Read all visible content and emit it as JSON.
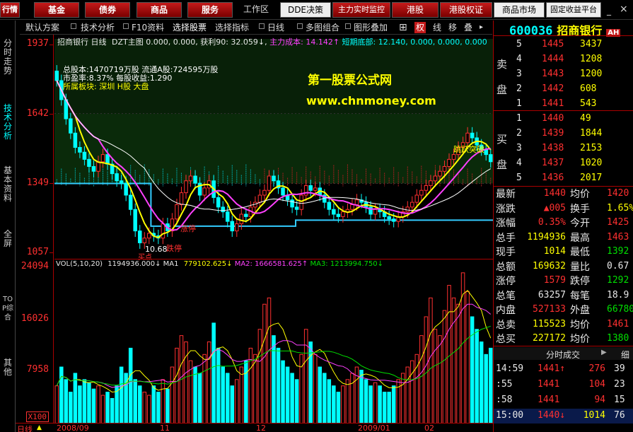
{
  "toolbar": {
    "buttons": [
      "行情",
      "基金",
      "债券",
      "商品",
      "服务"
    ],
    "workspace": "工作区",
    "tabs": [
      "DDE决策",
      "主力实时监控",
      "港股",
      "港股权证",
      "商品市场",
      "固定收益平台"
    ]
  },
  "subbar": {
    "items": [
      "默认方案",
      "技术分析",
      "F10资料",
      "选择股票",
      "选择指标",
      "日线",
      "多图组合",
      "图形叠加"
    ],
    "right_icons": [
      "权",
      "线",
      "移",
      "叠"
    ]
  },
  "left_tabs": [
    "分时走势",
    "技术分析",
    "基本资料",
    "全屏",
    "TOP综合",
    "其他"
  ],
  "header_line": {
    "stock": "招商银行 日线",
    "dzt": "DZT主图",
    "values": "0.000, 0.000, 获利90: 32.059↓,",
    "cost_label": "主力成本:",
    "cost": "14.142↑",
    "bottom_label": "短期底部:",
    "bottom": "12.140, 0.000, 0.000, 0.000"
  },
  "info_block": {
    "line1": "总股本:1470719万股 流通A股:724595万股",
    "line2": "市盈率:8.37%  每股收益:1.290",
    "line3": "所属板块: 深圳 H股 大盘"
  },
  "watermark": {
    "title": "第一股票公式网",
    "url": "www.chnmoney.com"
  },
  "chart_labels": {
    "low_price": "10.68",
    "surge": "涨停",
    "surge2": "涨停",
    "stop": "跌停",
    "break_label": "跳跃突破",
    "buy_label": "买点"
  },
  "price_axis": [
    "1937",
    "1642",
    "1349",
    "1057"
  ],
  "vol_axis": [
    "24094",
    "16026",
    "7958",
    "X100"
  ],
  "vol_header": {
    "label": "VOL(5,10,20)",
    "vol": "1194936.000↓",
    "ma1_label": "MA1",
    "ma1": "779102.625↓",
    "ma2_label": "MA2:",
    "ma2": "1666581.625↑",
    "ma3_label": "MA3:",
    "ma3": "1213994.750↓"
  },
  "date_axis": {
    "period": "日线",
    "dates": [
      "2008/09",
      "11",
      "12",
      "2009/01",
      "02"
    ]
  },
  "quote": {
    "code": "600036",
    "name": "招商银行",
    "badge": "AH",
    "sell_label": [
      "卖",
      "盘"
    ],
    "buy_label": [
      "买",
      "盘"
    ],
    "sell": [
      {
        "lvl": "5",
        "price": "1445",
        "vol": "3437"
      },
      {
        "lvl": "4",
        "price": "1444",
        "vol": "1208"
      },
      {
        "lvl": "3",
        "price": "1443",
        "vol": "1200"
      },
      {
        "lvl": "2",
        "price": "1442",
        "vol": "608"
      },
      {
        "lvl": "1",
        "price": "1441",
        "vol": "543"
      }
    ],
    "buy": [
      {
        "lvl": "1",
        "price": "1440",
        "vol": "49"
      },
      {
        "lvl": "2",
        "price": "1439",
        "vol": "1844"
      },
      {
        "lvl": "3",
        "price": "1438",
        "vol": "2153"
      },
      {
        "lvl": "4",
        "price": "1437",
        "vol": "1020"
      },
      {
        "lvl": "5",
        "price": "1436",
        "vol": "2017"
      }
    ],
    "stats": [
      {
        "k1": "最新",
        "v1": "1440",
        "k2": "均价",
        "v2": "1420"
      },
      {
        "k1": "涨跌",
        "v1": "▲005",
        "k2": "换手",
        "v2": "1.65%"
      },
      {
        "k1": "涨幅",
        "v1": "0.35%",
        "k2": "今开",
        "v2": "1425"
      },
      {
        "k1": "总手",
        "v1": "1194936",
        "k2": "最高",
        "v2": "1463"
      },
      {
        "k1": "现手",
        "v1": "1014",
        "k2": "最低",
        "v2": "1392"
      },
      {
        "k1": "总额",
        "v1": "169632",
        "k2": "量比",
        "v2": "0.67"
      },
      {
        "k1": "涨停",
        "v1": "1579",
        "k2": "跌停",
        "v2": "1292"
      },
      {
        "k1": "总笔",
        "v1": "63257",
        "k2": "每笔",
        "v2": "18.9"
      },
      {
        "k1": "内盘",
        "v1": "527133",
        "k2": "外盘",
        "v2": "667803"
      },
      {
        "k1": "总卖",
        "v1": "115523",
        "k2": "均价",
        "v2": "1461"
      },
      {
        "k1": "总买",
        "v1": "227172",
        "k2": "均价",
        "v2": "1380"
      }
    ],
    "trades_tab": "分时成交",
    "trades_tab2": "细",
    "trades": [
      {
        "time": "14:59",
        "price": "1441↑",
        "vol": "276",
        "n": "39"
      },
      {
        "time": ":55",
        "price": "1441",
        "vol": "104",
        "n": "23"
      },
      {
        "time": ":58",
        "price": "1441",
        "vol": "94",
        "n": "15"
      },
      {
        "time": "15:00",
        "price": "1440↓",
        "vol": "1014",
        "n": "76"
      }
    ]
  },
  "colors": {
    "up": "#ff3030",
    "down": "#00ffff",
    "ma5": "#ffff00",
    "ma10": "#ff40ff",
    "ma20": "#ffffff",
    "support": "#33ccff"
  },
  "chart_data": {
    "type": "candlestick",
    "closes": [
      1780,
      1700,
      1620,
      1560,
      1500,
      1480,
      1450,
      1420,
      1400,
      1440,
      1470,
      1430,
      1390,
      1360,
      1350,
      1300,
      1240,
      1150,
      1100,
      1120,
      1140,
      1130,
      1120,
      1180,
      1150,
      1200,
      1260,
      1310,
      1360,
      1380,
      1350,
      1300,
      1330,
      1360,
      1290,
      1250,
      1230,
      1190,
      1150,
      1180,
      1220,
      1210,
      1250,
      1270,
      1300,
      1320,
      1380,
      1360,
      1330,
      1300,
      1280,
      1250,
      1240,
      1300,
      1340,
      1320,
      1330,
      1300,
      1270,
      1240,
      1220,
      1210,
      1230,
      1240,
      1260,
      1280,
      1270,
      1250,
      1220,
      1240,
      1230,
      1210,
      1200,
      1190,
      1210,
      1230,
      1250,
      1270,
      1300,
      1320,
      1340,
      1360,
      1380,
      1400,
      1420,
      1450,
      1470,
      1500,
      1520,
      1560,
      1540,
      1510,
      1490,
      1470,
      1440
    ],
    "volumes": [
      6000,
      9000,
      7000,
      5000,
      8000,
      6000,
      7000,
      6500,
      5500,
      6000,
      4500,
      5000,
      4000,
      6000,
      9000,
      8000,
      12000,
      7000,
      6000,
      5000,
      4500,
      6000,
      5000,
      7000,
      5500,
      9000,
      12000,
      14000,
      13000,
      10000,
      9000,
      8000,
      11000,
      13000,
      16000,
      12000,
      9000,
      8000,
      6000,
      7000,
      9000,
      10000,
      12000,
      11000,
      15000,
      19000,
      20000,
      14000,
      12000,
      10000,
      9000,
      8000,
      7000,
      11000,
      15000,
      13000,
      11000,
      9000,
      8000,
      7000,
      6000,
      5000,
      6000,
      7000,
      8000,
      9000,
      8500,
      7000,
      6000,
      6500,
      6000,
      5000,
      5000,
      6000,
      7000,
      8000,
      9000,
      10000,
      11000,
      14000,
      17000,
      20000,
      15000,
      14000,
      18000,
      22000,
      20000,
      19000,
      24000,
      21000,
      17000,
      15000,
      13000,
      11000,
      12000
    ],
    "ylim": [
      1057,
      1937
    ],
    "vol_ylim": [
      0,
      24094
    ]
  }
}
